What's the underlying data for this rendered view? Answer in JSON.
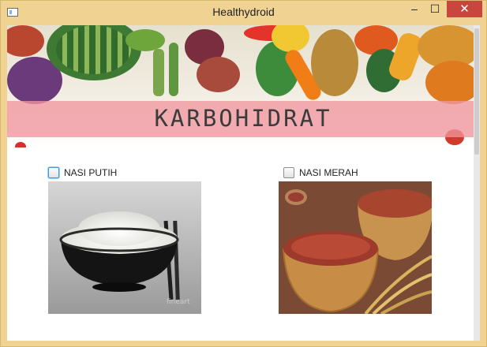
{
  "window": {
    "title": "Healthydroid",
    "minimize_glyph": "–",
    "maximize_glyph": "☐",
    "close_glyph": "✕"
  },
  "banner": {
    "title": "KARBOHIDRAT"
  },
  "options": [
    {
      "label": "NASI PUTIH",
      "checked": false,
      "focused": true
    },
    {
      "label": "NASI MERAH",
      "checked": false,
      "focused": false
    }
  ],
  "colors": {
    "banner_band": "#f0969e",
    "titlebar": "#f0d293",
    "close_button": "#c7463d"
  }
}
